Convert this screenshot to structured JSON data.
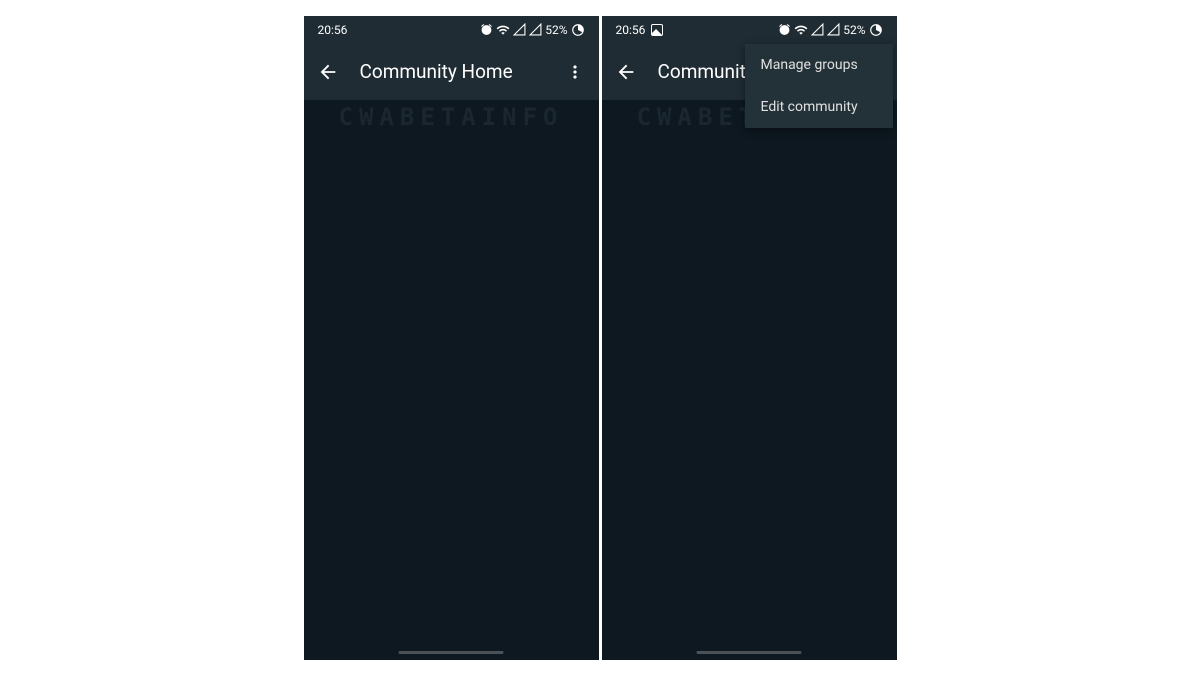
{
  "left": {
    "status": {
      "time": "20:56",
      "hasPicIcon": false,
      "battery": "52%"
    },
    "header": {
      "title": "Community Home",
      "showMenu": false
    },
    "watermark": "CWABETAINFO"
  },
  "right": {
    "status": {
      "time": "20:56",
      "hasPicIcon": true,
      "battery": "52%"
    },
    "header": {
      "title": "Community H",
      "showMenu": true
    },
    "menu": {
      "items": [
        {
          "label": "Manage groups"
        },
        {
          "label": "Edit community"
        }
      ]
    },
    "watermark": "CWABETAINFO"
  }
}
